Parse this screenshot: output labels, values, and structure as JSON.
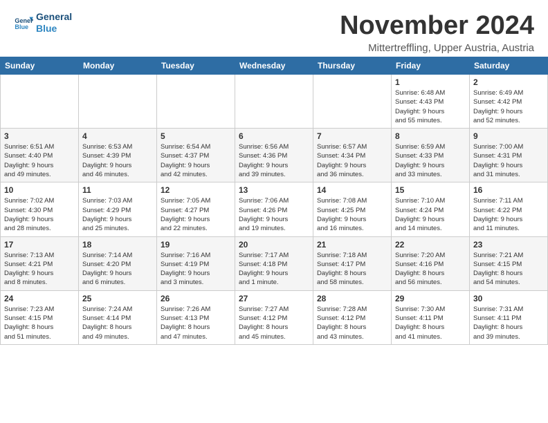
{
  "header": {
    "logo_line1": "General",
    "logo_line2": "Blue",
    "month_title": "November 2024",
    "location": "Mittertreffling, Upper Austria, Austria"
  },
  "weekdays": [
    "Sunday",
    "Monday",
    "Tuesday",
    "Wednesday",
    "Thursday",
    "Friday",
    "Saturday"
  ],
  "weeks": [
    [
      {
        "day": "",
        "info": ""
      },
      {
        "day": "",
        "info": ""
      },
      {
        "day": "",
        "info": ""
      },
      {
        "day": "",
        "info": ""
      },
      {
        "day": "",
        "info": ""
      },
      {
        "day": "1",
        "info": "Sunrise: 6:48 AM\nSunset: 4:43 PM\nDaylight: 9 hours\nand 55 minutes."
      },
      {
        "day": "2",
        "info": "Sunrise: 6:49 AM\nSunset: 4:42 PM\nDaylight: 9 hours\nand 52 minutes."
      }
    ],
    [
      {
        "day": "3",
        "info": "Sunrise: 6:51 AM\nSunset: 4:40 PM\nDaylight: 9 hours\nand 49 minutes."
      },
      {
        "day": "4",
        "info": "Sunrise: 6:53 AM\nSunset: 4:39 PM\nDaylight: 9 hours\nand 46 minutes."
      },
      {
        "day": "5",
        "info": "Sunrise: 6:54 AM\nSunset: 4:37 PM\nDaylight: 9 hours\nand 42 minutes."
      },
      {
        "day": "6",
        "info": "Sunrise: 6:56 AM\nSunset: 4:36 PM\nDaylight: 9 hours\nand 39 minutes."
      },
      {
        "day": "7",
        "info": "Sunrise: 6:57 AM\nSunset: 4:34 PM\nDaylight: 9 hours\nand 36 minutes."
      },
      {
        "day": "8",
        "info": "Sunrise: 6:59 AM\nSunset: 4:33 PM\nDaylight: 9 hours\nand 33 minutes."
      },
      {
        "day": "9",
        "info": "Sunrise: 7:00 AM\nSunset: 4:31 PM\nDaylight: 9 hours\nand 31 minutes."
      }
    ],
    [
      {
        "day": "10",
        "info": "Sunrise: 7:02 AM\nSunset: 4:30 PM\nDaylight: 9 hours\nand 28 minutes."
      },
      {
        "day": "11",
        "info": "Sunrise: 7:03 AM\nSunset: 4:29 PM\nDaylight: 9 hours\nand 25 minutes."
      },
      {
        "day": "12",
        "info": "Sunrise: 7:05 AM\nSunset: 4:27 PM\nDaylight: 9 hours\nand 22 minutes."
      },
      {
        "day": "13",
        "info": "Sunrise: 7:06 AM\nSunset: 4:26 PM\nDaylight: 9 hours\nand 19 minutes."
      },
      {
        "day": "14",
        "info": "Sunrise: 7:08 AM\nSunset: 4:25 PM\nDaylight: 9 hours\nand 16 minutes."
      },
      {
        "day": "15",
        "info": "Sunrise: 7:10 AM\nSunset: 4:24 PM\nDaylight: 9 hours\nand 14 minutes."
      },
      {
        "day": "16",
        "info": "Sunrise: 7:11 AM\nSunset: 4:22 PM\nDaylight: 9 hours\nand 11 minutes."
      }
    ],
    [
      {
        "day": "17",
        "info": "Sunrise: 7:13 AM\nSunset: 4:21 PM\nDaylight: 9 hours\nand 8 minutes."
      },
      {
        "day": "18",
        "info": "Sunrise: 7:14 AM\nSunset: 4:20 PM\nDaylight: 9 hours\nand 6 minutes."
      },
      {
        "day": "19",
        "info": "Sunrise: 7:16 AM\nSunset: 4:19 PM\nDaylight: 9 hours\nand 3 minutes."
      },
      {
        "day": "20",
        "info": "Sunrise: 7:17 AM\nSunset: 4:18 PM\nDaylight: 9 hours\nand 1 minute."
      },
      {
        "day": "21",
        "info": "Sunrise: 7:18 AM\nSunset: 4:17 PM\nDaylight: 8 hours\nand 58 minutes."
      },
      {
        "day": "22",
        "info": "Sunrise: 7:20 AM\nSunset: 4:16 PM\nDaylight: 8 hours\nand 56 minutes."
      },
      {
        "day": "23",
        "info": "Sunrise: 7:21 AM\nSunset: 4:15 PM\nDaylight: 8 hours\nand 54 minutes."
      }
    ],
    [
      {
        "day": "24",
        "info": "Sunrise: 7:23 AM\nSunset: 4:15 PM\nDaylight: 8 hours\nand 51 minutes."
      },
      {
        "day": "25",
        "info": "Sunrise: 7:24 AM\nSunset: 4:14 PM\nDaylight: 8 hours\nand 49 minutes."
      },
      {
        "day": "26",
        "info": "Sunrise: 7:26 AM\nSunset: 4:13 PM\nDaylight: 8 hours\nand 47 minutes."
      },
      {
        "day": "27",
        "info": "Sunrise: 7:27 AM\nSunset: 4:12 PM\nDaylight: 8 hours\nand 45 minutes."
      },
      {
        "day": "28",
        "info": "Sunrise: 7:28 AM\nSunset: 4:12 PM\nDaylight: 8 hours\nand 43 minutes."
      },
      {
        "day": "29",
        "info": "Sunrise: 7:30 AM\nSunset: 4:11 PM\nDaylight: 8 hours\nand 41 minutes."
      },
      {
        "day": "30",
        "info": "Sunrise: 7:31 AM\nSunset: 4:11 PM\nDaylight: 8 hours\nand 39 minutes."
      }
    ]
  ]
}
